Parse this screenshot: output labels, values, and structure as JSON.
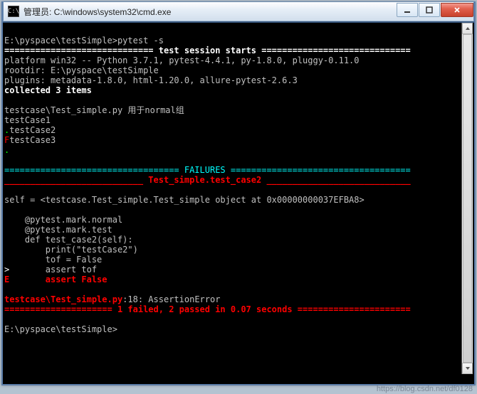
{
  "titlebar": {
    "icon_glyph": "C:\\",
    "title": "管理员: C:\\windows\\system32\\cmd.exe"
  },
  "prompt1": "E:\\pyspace\\testSimple>",
  "command": "pytest -s",
  "session": {
    "header_line": "============================= test session starts =============================",
    "platform": "platform win32 -- Python 3.7.1, pytest-4.4.1, py-1.8.0, pluggy-0.11.0",
    "rootdir": "rootdir: E:\\pyspace\\testSimple",
    "plugins": "plugins: metadata-1.8.0, html-1.20.0, allure-pytest-2.6.3",
    "collected": "collected 3 items"
  },
  "run": {
    "file": "testcase\\Test_simple.py ",
    "group": "用于normal组",
    "c1": "testCase1",
    "dot": ".",
    "c2": "testCase2",
    "F": "F",
    "c3": "testCase3",
    "dot2": "."
  },
  "fail": {
    "header": "================================== FAILURES ===================================",
    "title": "___________________________ Test_simple.test_case2 ____________________________",
    "self_line": "self = <testcase.Test_simple.Test_simple object at 0x00000000037EFBA8>",
    "src1": "    @pytest.mark.normal",
    "src2": "    @pytest.mark.test",
    "src3": "    def test_case2(self):",
    "src4": "        print(\"testCase2\")",
    "src5": "        tof = False",
    "marker": ">",
    "src6": "       assert tof",
    "E": "E",
    "err": "       assert False",
    "loc": "testcase\\Test_simple.py",
    "loc2": ":18: AssertionError",
    "summary": "===================== 1 failed, 2 passed in 0.07 seconds ======================"
  },
  "prompt2": "E:\\pyspace\\testSimple>",
  "watermark": "https://blog.csdn.net/df0128"
}
